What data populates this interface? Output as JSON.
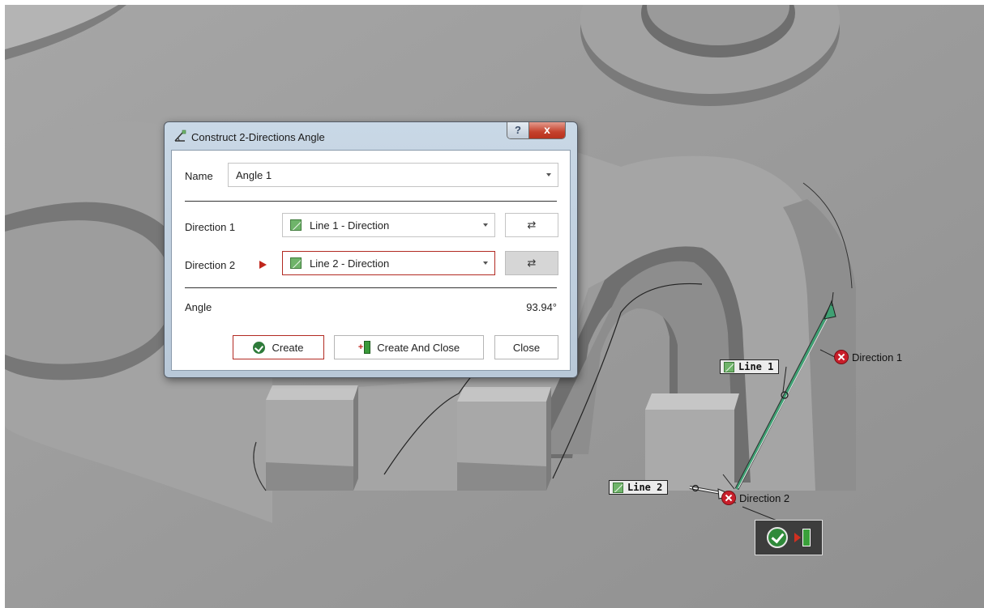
{
  "dialog": {
    "title": "Construct 2-Directions Angle",
    "help_glyph": "?",
    "close_glyph": "x",
    "name_label": "Name",
    "name_value": "Angle 1",
    "direction1_label": "Direction 1",
    "direction1_value": "Line 1 - Direction",
    "direction2_label": "Direction 2",
    "direction2_value": "Line 2 - Direction",
    "swap_glyph": "⇄",
    "angle_label": "Angle",
    "angle_value": "93.94°",
    "create_label": "Create",
    "create_close_label": "Create And Close",
    "close_label": "Close"
  },
  "viewport": {
    "line1_label": "Line 1",
    "line2_label": "Line 2",
    "direction1_label": "Direction 1",
    "direction2_label": "Direction 2"
  }
}
